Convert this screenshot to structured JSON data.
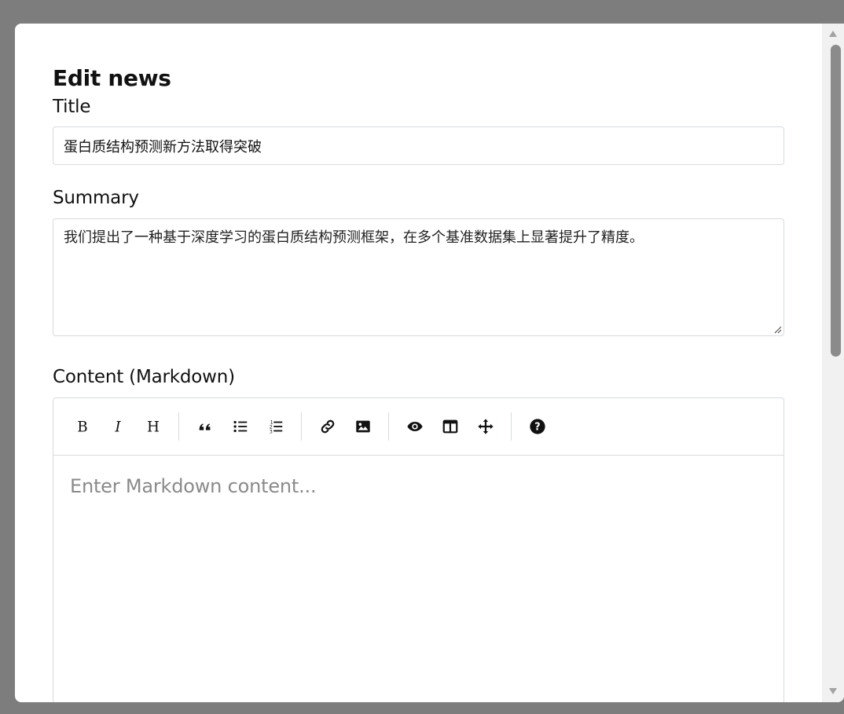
{
  "modal": {
    "title": "Edit news",
    "title_field": {
      "label": "Title",
      "value": "蛋白质结构预测新方法取得突破"
    },
    "summary_field": {
      "label": "Summary",
      "value": "我们提出了一种基于深度学习的蛋白质结构预测框架，在多个基准数据集上显著提升了精度。"
    },
    "content_field": {
      "label": "Content (Markdown)",
      "placeholder": "Enter Markdown content...",
      "value": ""
    },
    "toolbar": {
      "groups": [
        [
          "bold-icon",
          "italic-icon",
          "heading-icon"
        ],
        [
          "quote-icon",
          "unordered-list-icon",
          "ordered-list-icon"
        ],
        [
          "link-icon",
          "image-icon"
        ],
        [
          "preview-icon",
          "side-by-side-icon",
          "fullscreen-icon"
        ],
        [
          "help-icon"
        ]
      ]
    }
  },
  "colors": {
    "backdrop": "#7d7d7d",
    "modal_bg": "#ffffff",
    "border": "#d7dadd",
    "text": "#111111",
    "placeholder": "#8a8a8a",
    "scrollbar_thumb": "#8b8b8b"
  }
}
